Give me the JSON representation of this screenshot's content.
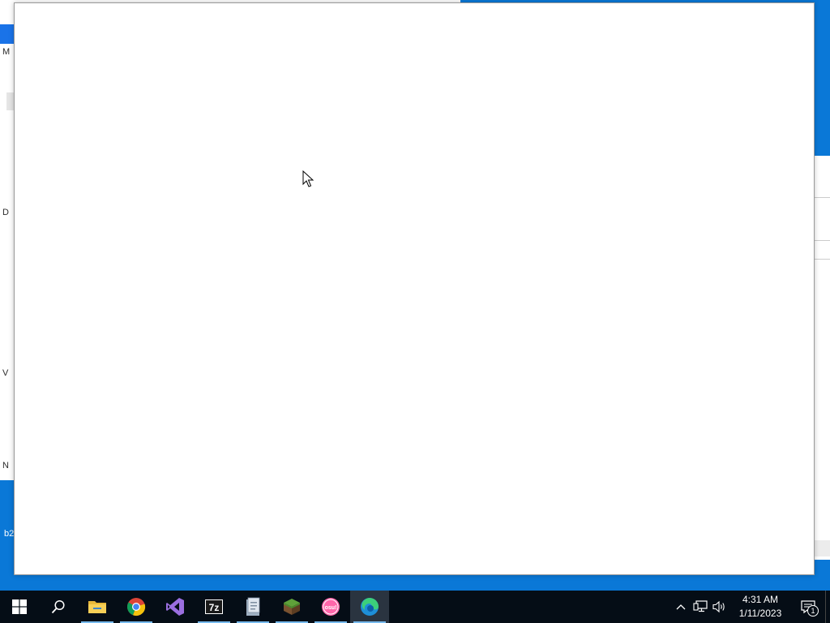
{
  "desktop": {
    "left_window_letters": [
      "M",
      "D",
      "V",
      "N"
    ],
    "desktop_icon_label": "b2"
  },
  "colors": {
    "desktop_bg": "#0a78d7",
    "taskbar_bg": "#050d16",
    "window_bg": "#ffffff",
    "running_indicator": "#76b9ed"
  },
  "taskbar": {
    "buttons": [
      {
        "name": "start-button",
        "icon": "windows-logo-icon"
      },
      {
        "name": "search-button",
        "icon": "search-icon"
      },
      {
        "name": "file-explorer-button",
        "icon": "folder-icon",
        "running": true
      },
      {
        "name": "chrome-button",
        "icon": "chrome-icon",
        "running": true
      },
      {
        "name": "visual-studio-button",
        "icon": "visual-studio-icon"
      },
      {
        "name": "7zip-button",
        "icon": "7zip-icon",
        "label": "7z",
        "running": true
      },
      {
        "name": "app-button",
        "icon": "document-app-icon",
        "running": true
      },
      {
        "name": "minecraft-button",
        "icon": "grass-block-icon",
        "running": true
      },
      {
        "name": "osu-button",
        "icon": "osu-icon",
        "label": "osu!",
        "running": true
      },
      {
        "name": "edge-button",
        "icon": "edge-icon",
        "running": true,
        "active": true
      }
    ],
    "tray": {
      "clock_time": "4:31 AM",
      "clock_date": "1/11/2023",
      "notification_count": "1"
    }
  }
}
